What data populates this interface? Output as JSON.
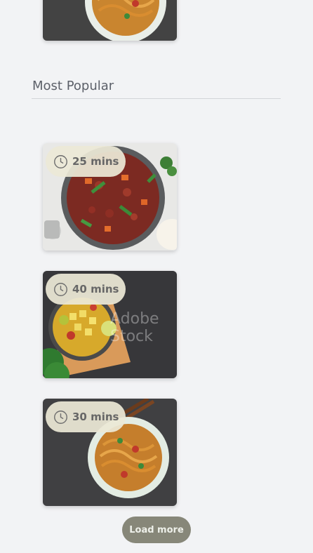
{
  "section": {
    "title": "Most Popular"
  },
  "recipes": [
    {
      "time": "25 mins",
      "icon": "clock-icon"
    },
    {
      "time": "40 mins",
      "icon": "clock-icon"
    },
    {
      "time": "30 mins",
      "icon": "clock-icon"
    }
  ],
  "load_more_label": "Load more",
  "colors": {
    "background": "#f2f3f5",
    "badge_bg": "#ece8d6",
    "badge_text": "#676767",
    "button_bg": "#878779",
    "button_text": "#eef0ea"
  }
}
